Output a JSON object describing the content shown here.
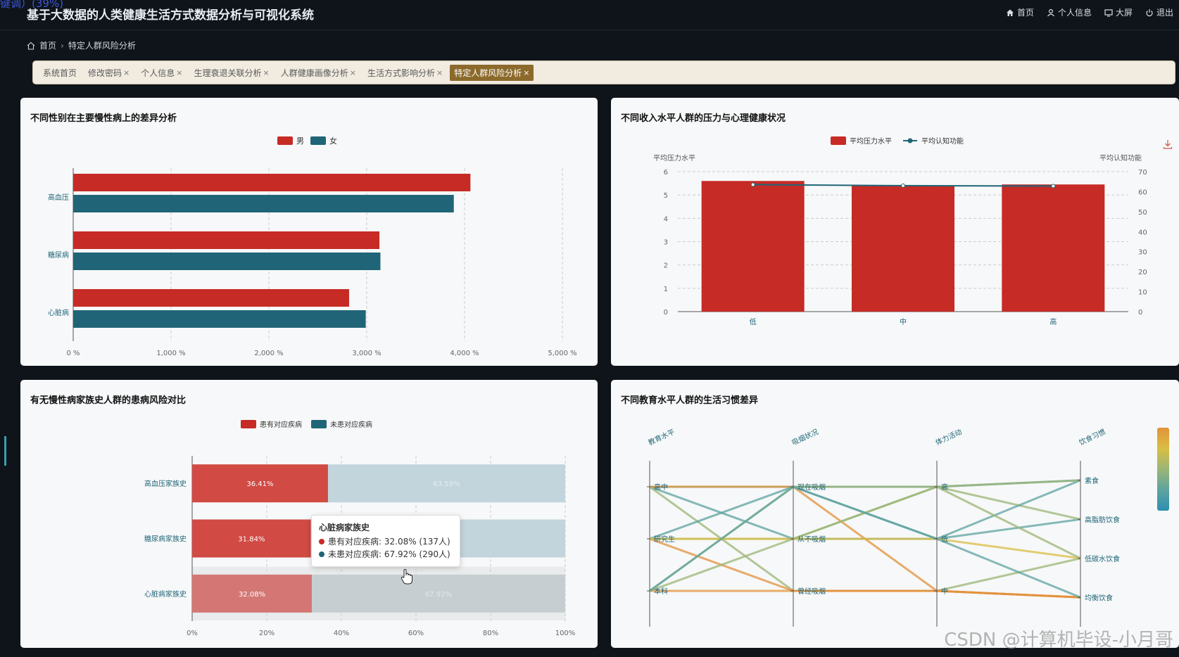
{
  "app": {
    "title": "基于大数据的人类健康生活方式数据分析与可视化系统",
    "corner_text": "键调）(39%)"
  },
  "topnav": [
    {
      "label": "首页",
      "icon": "home-icon"
    },
    {
      "label": "个人信息",
      "icon": "user-icon"
    },
    {
      "label": "大屏",
      "icon": "monitor-icon"
    },
    {
      "label": "退出",
      "icon": "power-icon"
    }
  ],
  "breadcrumb": {
    "home": "首页",
    "current": "特定人群风险分析"
  },
  "tabs": [
    {
      "label": "系统首页",
      "closable": false,
      "active": false
    },
    {
      "label": "修改密码",
      "closable": true,
      "active": false
    },
    {
      "label": "个人信息",
      "closable": true,
      "active": false
    },
    {
      "label": "生理衰退关联分析",
      "closable": true,
      "active": false
    },
    {
      "label": "人群健康画像分析",
      "closable": true,
      "active": false
    },
    {
      "label": "生活方式影响分析",
      "closable": true,
      "active": false
    },
    {
      "label": "特定人群风险分析",
      "closable": true,
      "active": true
    }
  ],
  "tab_close_glyph": "×",
  "colors": {
    "red": "#c62b26",
    "teal": "#1f6577",
    "light_red": "#d14a44",
    "faded_red": "#d47774",
    "light_teal": "#c3d5dc",
    "faded_teal": "#c6ced2"
  },
  "watermark": "CSDN @计算机毕设-小月哥",
  "chart_data": [
    {
      "id": "gender",
      "title": "不同性别在主要慢性病上的差异分析",
      "type": "bar",
      "orientation": "horizontal",
      "categories": [
        "高血压",
        "糖尿病",
        "心脏病"
      ],
      "series": [
        {
          "name": "男",
          "values": [
            4060,
            3130,
            2820
          ]
        },
        {
          "name": "女",
          "values": [
            3890,
            3140,
            2990
          ]
        }
      ],
      "xlim": [
        0,
        5000
      ],
      "xticks": [
        "0 %",
        "1,000 %",
        "2,000 %",
        "3,000 %",
        "4,000 %",
        "5,000 %"
      ],
      "legend": "top-center"
    },
    {
      "id": "income",
      "title": "不同收入水平人群的压力与心理健康状况",
      "type": "bar",
      "categories": [
        "低",
        "中",
        "高"
      ],
      "series": [
        {
          "name": "平均压力水平",
          "type": "bar",
          "axis": "left",
          "values": [
            5.6,
            5.4,
            5.45
          ]
        },
        {
          "name": "平均认知功能",
          "type": "line",
          "axis": "right",
          "values": [
            63.5,
            63.0,
            62.8
          ]
        }
      ],
      "ylabel": "平均压力水平",
      "y2label": "平均认知功能",
      "ylim": [
        0,
        6
      ],
      "y2lim": [
        0,
        70
      ],
      "yticks": [
        "0",
        "1",
        "2",
        "3",
        "4",
        "5",
        "6"
      ],
      "y2ticks": [
        "0",
        "10",
        "20",
        "30",
        "40",
        "50",
        "60",
        "70"
      ],
      "legend": "top-center"
    },
    {
      "id": "family",
      "title": "有无慢性病家族史人群的患病风险对比",
      "type": "bar",
      "orientation": "horizontal-stacked",
      "categories": [
        "高血压家族史",
        "糖尿病家族史",
        "心脏病家族史"
      ],
      "series": [
        {
          "name": "患有对应疾病",
          "values": [
            36.41,
            31.84,
            32.08
          ],
          "labels": [
            "36.41%",
            "31.84%",
            "32.08%"
          ]
        },
        {
          "name": "未患对应疾病",
          "values": [
            63.59,
            68.16,
            67.92
          ],
          "labels": [
            "63.59%",
            "68.16%",
            "67.92%"
          ]
        }
      ],
      "xlim": [
        0,
        100
      ],
      "xticks": [
        "0%",
        "20%",
        "40%",
        "60%",
        "80%",
        "100%"
      ],
      "legend": "top-center",
      "tooltip": {
        "title": "心脏病家族史",
        "line1": "患有对应疾病: 32.08% (137人)",
        "line2": "未患对应疾病: 67.92% (290人)"
      }
    },
    {
      "id": "education",
      "title": "不同教育水平人群的生活习惯差异",
      "type": "parallel",
      "axes": [
        {
          "name": "教育水平",
          "categories": [
            "本科",
            "研究生",
            "高中"
          ]
        },
        {
          "name": "吸烟状况",
          "categories": [
            "曾经吸烟",
            "从不吸烟",
            "现在吸烟"
          ]
        },
        {
          "name": "体力活动",
          "categories": [
            "中",
            "低",
            "高"
          ]
        },
        {
          "name": "饮食习惯",
          "categories": [
            "均衡饮食",
            "低碳水饮食",
            "高脂肪饮食",
            "素食"
          ]
        }
      ],
      "lines": [
        [
          2,
          2,
          2,
          3
        ],
        [
          2,
          1,
          1,
          2
        ],
        [
          2,
          0,
          0,
          1
        ],
        [
          2,
          2,
          0,
          0
        ],
        [
          1,
          1,
          2,
          2
        ],
        [
          1,
          2,
          1,
          3
        ],
        [
          1,
          0,
          0,
          0
        ],
        [
          1,
          1,
          1,
          1
        ],
        [
          0,
          0,
          0,
          0
        ],
        [
          0,
          2,
          2,
          1
        ],
        [
          0,
          1,
          2,
          3
        ],
        [
          0,
          2,
          1,
          0
        ]
      ],
      "line_values": [
        0.35,
        0.2,
        0.55,
        0.8,
        0.4,
        0.3,
        0.95,
        0.6,
        0.85,
        0.45,
        0.5,
        0.25
      ],
      "visual_map": "right"
    }
  ]
}
